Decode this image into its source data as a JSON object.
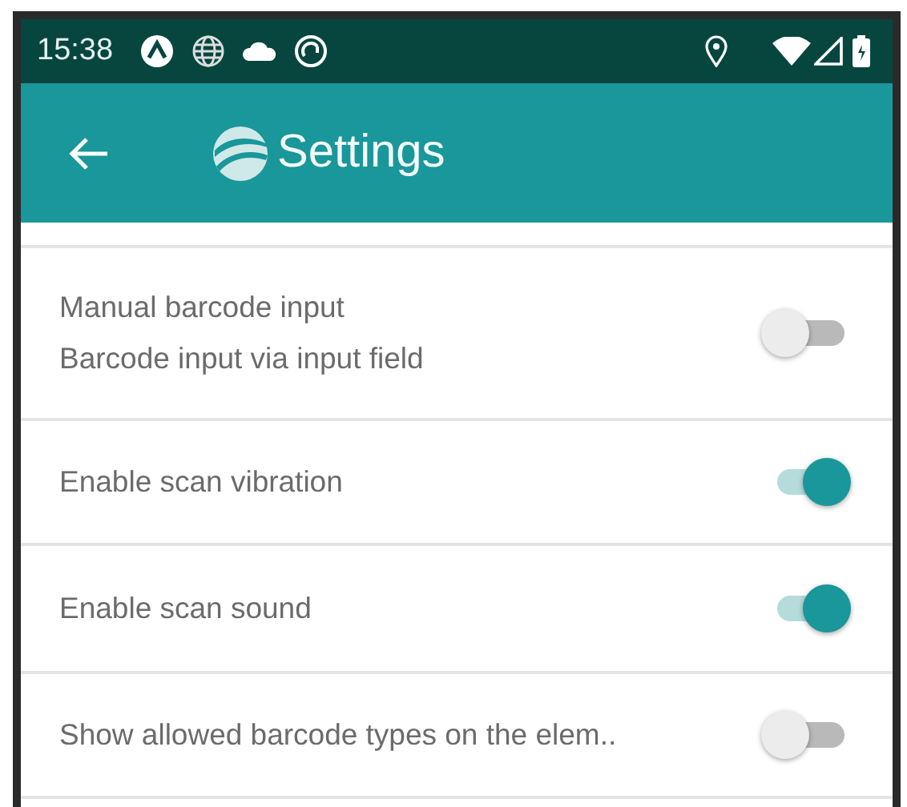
{
  "status_bar": {
    "time": "15:38"
  },
  "app_bar": {
    "title": "Settings"
  },
  "settings": [
    {
      "title": "Manual barcode input",
      "summary": "Barcode input via input field",
      "on": false
    },
    {
      "title": "Enable scan vibration",
      "on": true
    },
    {
      "title": "Enable scan sound",
      "on": true
    },
    {
      "title": "Show allowed barcode types on the elem..",
      "on": false
    }
  ]
}
